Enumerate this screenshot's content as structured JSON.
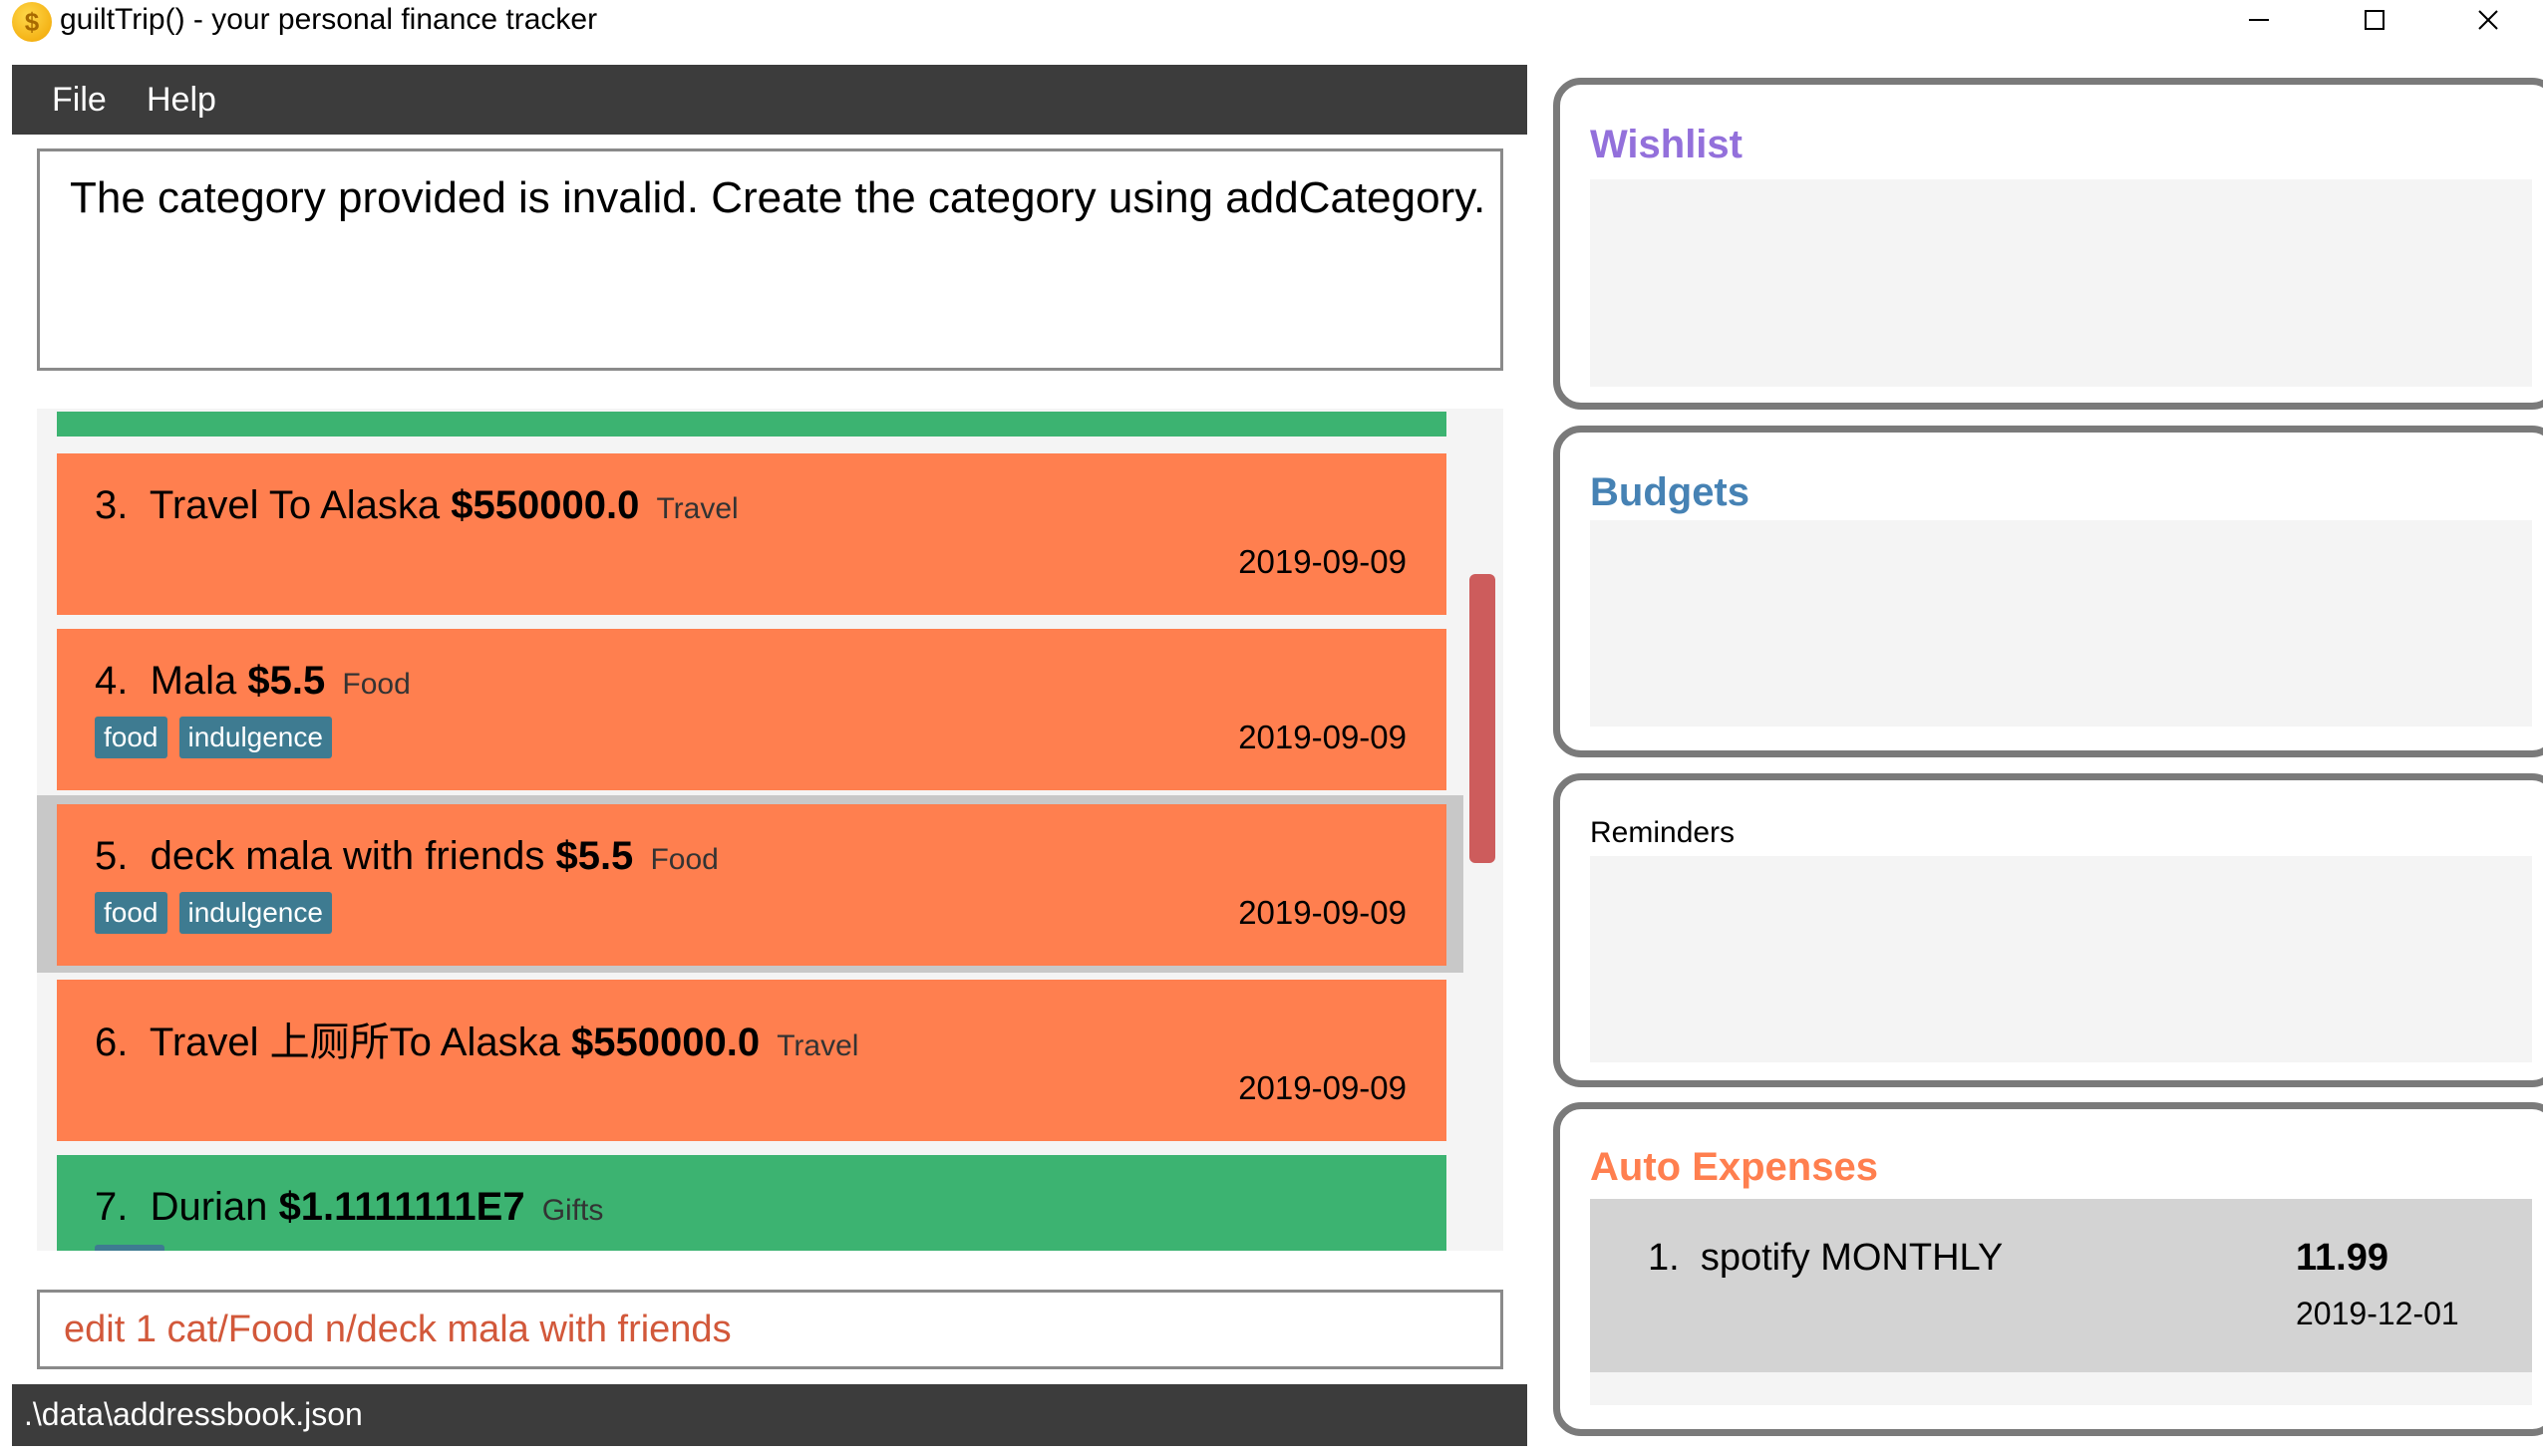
{
  "window": {
    "title": "guiltTrip() - your personal finance tracker",
    "app_icon_glyph": "$",
    "icons": [
      "minimize-icon",
      "maximize-icon",
      "close-icon"
    ]
  },
  "menu": {
    "items": [
      "File",
      "Help"
    ]
  },
  "result_display": {
    "text": "The category provided is invalid. Create the category using addCategory."
  },
  "expenses": [
    {
      "index": "3.",
      "name": "Travel To Alaska",
      "amount": "$550000.0",
      "category": "Travel",
      "date": "2019-09-09",
      "tags": [],
      "color": "#ff7f4f"
    },
    {
      "index": "4.",
      "name": "Mala",
      "amount": "$5.5",
      "category": "Food",
      "date": "2019-09-09",
      "tags": [
        "food",
        "indulgence"
      ],
      "color": "#ff7f4f"
    },
    {
      "index": "5.",
      "name": "deck mala with friends",
      "amount": "$5.5",
      "category": "Food",
      "date": "2019-09-09",
      "tags": [
        "food",
        "indulgence"
      ],
      "color": "#ff7f4f",
      "selected": true
    },
    {
      "index": "6.",
      "name": "Travel 上厕所To Alaska",
      "amount": "$550000.0",
      "category": "Travel",
      "date": "2019-09-09",
      "tags": [],
      "color": "#ff7f4f"
    },
    {
      "index": "7.",
      "name": "Durian",
      "amount": "$1.1111111E7",
      "category": "Gifts",
      "date": "",
      "tags": [],
      "color": "#3cb371"
    }
  ],
  "command_box": {
    "value": "edit 1 cat/Food n/deck mala with friends"
  },
  "status_bar": {
    "path": ".\\data\\addressbook.json"
  },
  "panels": {
    "wishlist": {
      "title": "Wishlist",
      "color": "#9370db"
    },
    "budgets": {
      "title": "Budgets",
      "color": "#4682b4"
    },
    "reminders": {
      "title": "Reminders",
      "color": "#000000"
    },
    "auto_expenses": {
      "title": "Auto Expenses",
      "color": "#ff7f4f",
      "items": [
        {
          "index": "1.",
          "description": "spotify",
          "frequency": "MONTHLY",
          "amount": "11.99",
          "date": "2019-12-01"
        }
      ]
    }
  }
}
